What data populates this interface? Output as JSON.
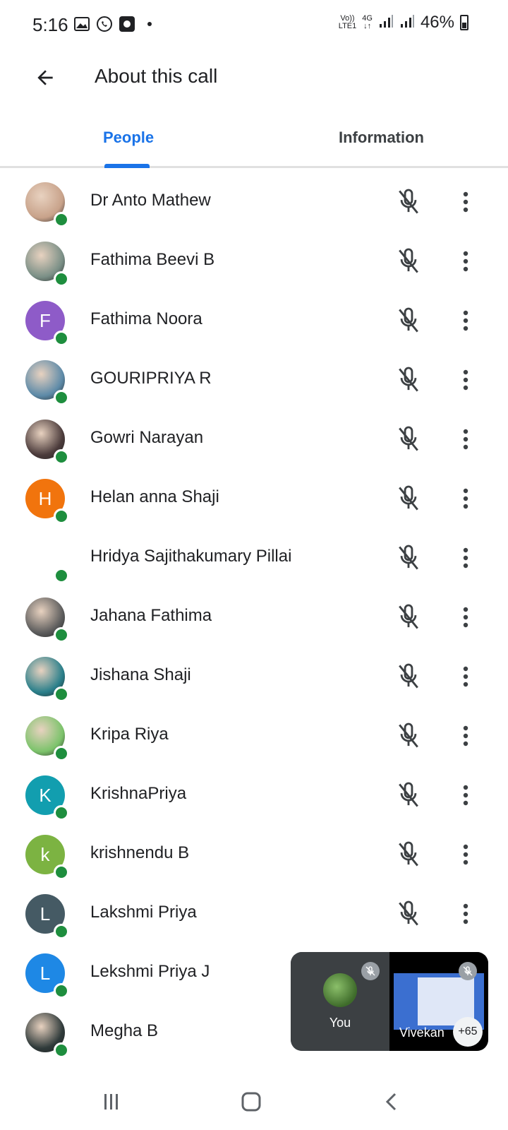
{
  "status_bar": {
    "time": "5:16",
    "icons": [
      "gallery-icon",
      "whatsapp-icon",
      "app-icon",
      "dot-icon"
    ],
    "network_top": "Vo))",
    "network_bottom": "LTE1",
    "data_top": "4G",
    "battery": "46%"
  },
  "header": {
    "title": "About this call"
  },
  "tabs": [
    {
      "label": "People",
      "active": true
    },
    {
      "label": "Information",
      "active": false
    }
  ],
  "participants": [
    {
      "name": "Dr Anto Mathew",
      "initial": "",
      "color": "#c8a28a"
    },
    {
      "name": "Fathima Beevi B",
      "initial": "",
      "color": "#7a8f86"
    },
    {
      "name": "Fathima Noora",
      "initial": "F",
      "color": "#8e5bc8"
    },
    {
      "name": "GOURIPRIYA R",
      "initial": "",
      "color": "#5d8aa8"
    },
    {
      "name": "Gowri Narayan",
      "initial": "",
      "color": "#4b3b3b"
    },
    {
      "name": "Helan anna Shaji",
      "initial": "H",
      "color": "#f1740d"
    },
    {
      "name": "Hridya Sajithakumary Pillai",
      "initial": "",
      "color": "#ffffff"
    },
    {
      "name": "Jahana Fathima",
      "initial": "",
      "color": "#5c5c5c"
    },
    {
      "name": "Jishana Shaji",
      "initial": "",
      "color": "#2a7f8a"
    },
    {
      "name": "Kripa Riya",
      "initial": "",
      "color": "#7cc36b"
    },
    {
      "name": "KrishnaPriya",
      "initial": "K",
      "color": "#129eaf"
    },
    {
      "name": "krishnendu B",
      "initial": "k",
      "color": "#7cb342"
    },
    {
      "name": "Lakshmi Priya",
      "initial": "L",
      "color": "#455a64"
    },
    {
      "name": "Lekshmi Priya J",
      "initial": "L",
      "color": "#1e88e5"
    },
    {
      "name": "Megha B",
      "initial": "",
      "color": "#2f3a3a"
    }
  ],
  "pip": {
    "you_label": "You",
    "other_label": "Vivekan",
    "count": "+65"
  },
  "colors": {
    "accent": "#1a73e8",
    "online": "#1e8e3e"
  }
}
